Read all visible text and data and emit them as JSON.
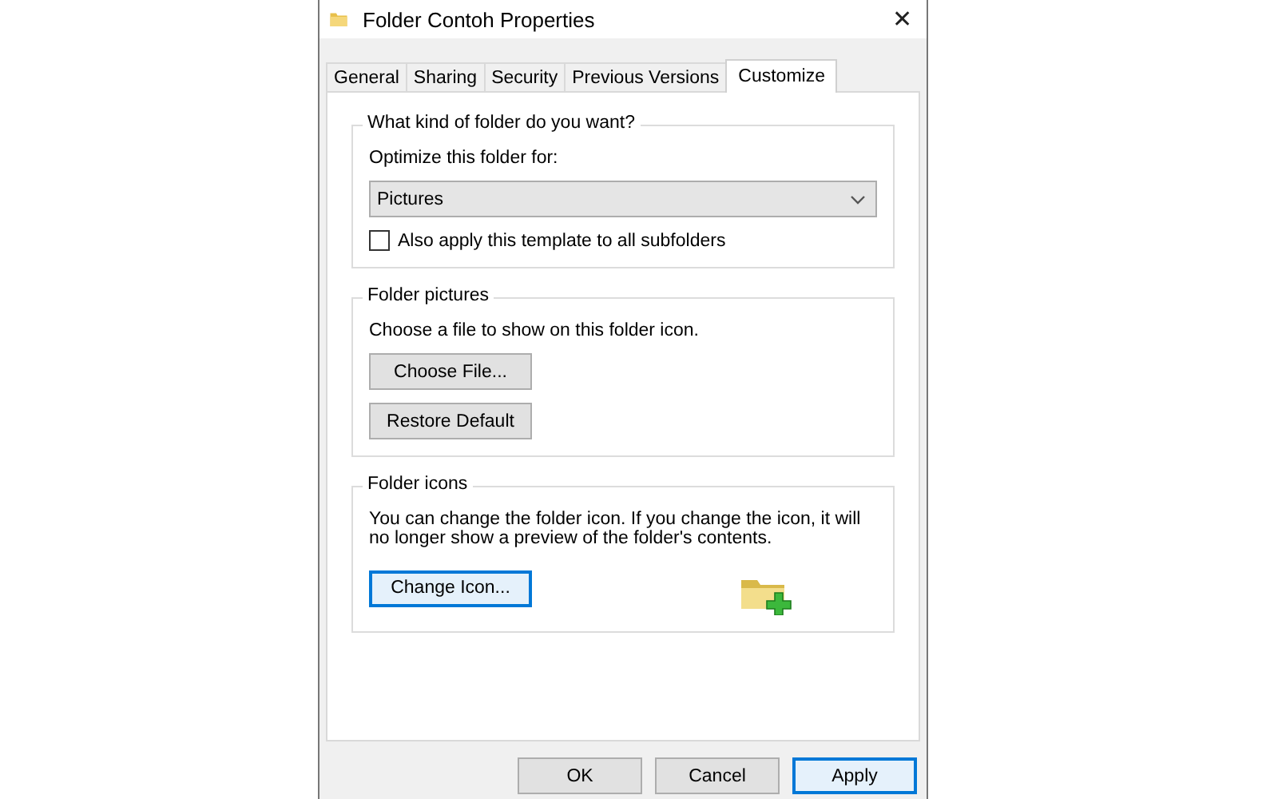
{
  "window": {
    "title": "Folder Contoh Properties",
    "close": "✕"
  },
  "tabs": [
    {
      "label": "General",
      "selected": false
    },
    {
      "label": "Sharing",
      "selected": false
    },
    {
      "label": "Security",
      "selected": false
    },
    {
      "label": "Previous Versions",
      "selected": false
    },
    {
      "label": "Customize",
      "selected": true
    }
  ],
  "groups": [
    {
      "legend": "What kind of folder do you want?",
      "items": [
        {
          "kind": "label",
          "text": "Optimize this folder for:"
        },
        {
          "kind": "dropdown",
          "value": "Pictures"
        },
        {
          "kind": "checkbox",
          "label": "Also apply this template to all subfolders",
          "checked": false
        }
      ]
    },
    {
      "legend": "Folder pictures",
      "items": [
        {
          "kind": "label",
          "text": "Choose a file to show on this folder icon."
        },
        {
          "kind": "button",
          "label": "Choose File...",
          "focused": false
        },
        {
          "kind": "button",
          "label": "Restore Default",
          "focused": false
        }
      ]
    },
    {
      "legend": "Folder icons",
      "items": [
        {
          "kind": "label",
          "text": "You can change the folder icon. If you change the icon, it will no longer show a preview of the folder's contents."
        },
        {
          "kind": "button",
          "label": "Change Icon...",
          "focused": true,
          "preview": true
        }
      ]
    }
  ],
  "buttons": [
    {
      "label": "OK",
      "focused": false
    },
    {
      "label": "Cancel",
      "focused": false
    },
    {
      "label": "Apply",
      "focused": true
    }
  ]
}
